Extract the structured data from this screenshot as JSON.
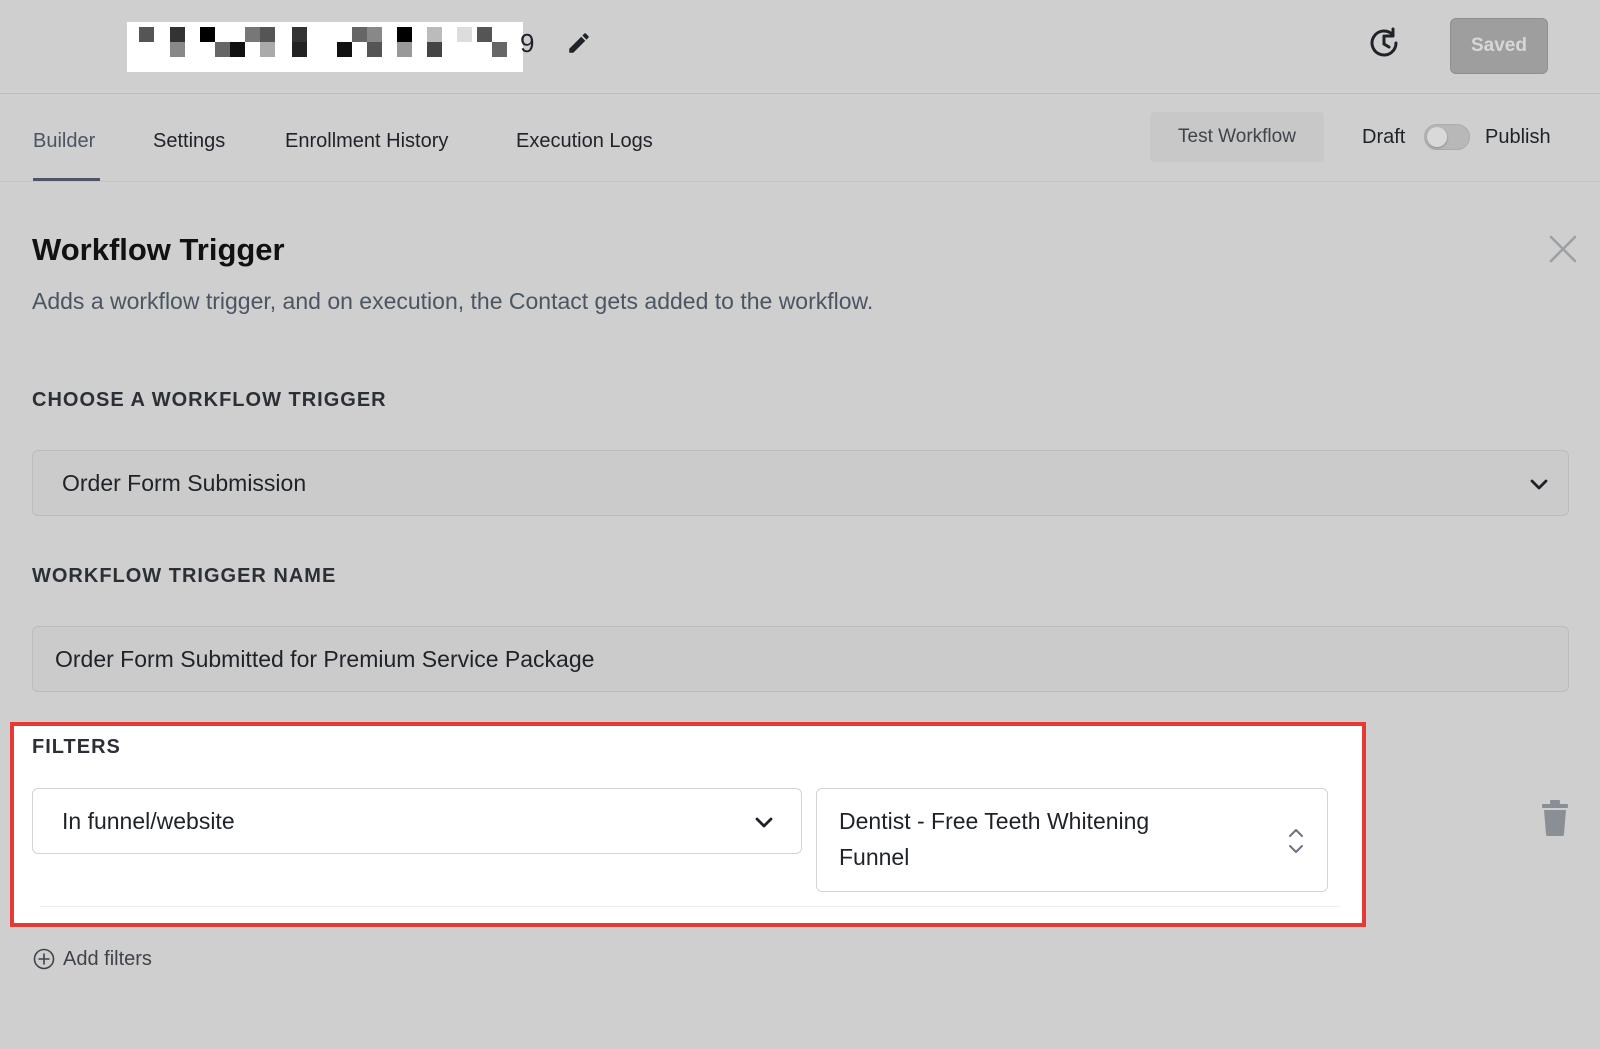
{
  "header": {
    "workflow_name_suffix": "9",
    "saved_label": "Saved",
    "icons": [
      "edit-icon",
      "history-icon"
    ]
  },
  "tabs": [
    {
      "label": "Builder",
      "active": true
    },
    {
      "label": "Settings",
      "active": false
    },
    {
      "label": "Enrollment History",
      "active": false
    },
    {
      "label": "Execution Logs",
      "active": false
    }
  ],
  "actions": {
    "test_workflow_label": "Test Workflow",
    "draft_label": "Draft",
    "publish_label": "Publish",
    "publish_toggle_on": false
  },
  "panel": {
    "title": "Workflow Trigger",
    "subtitle": "Adds a workflow trigger, and on execution, the Contact gets added to the workflow.",
    "trigger_section_label": "CHOOSE A WORKFLOW TRIGGER",
    "trigger_value": "Order Form Submission",
    "name_section_label": "WORKFLOW TRIGGER NAME",
    "name_value": "Order Form Submitted for Premium Service Package",
    "filters_section_label": "FILTERS",
    "filter_field_value": "In funnel/website",
    "filter_value_line1": "Dentist - Free Teeth Whitening",
    "filter_value_line2": "Funnel",
    "add_filters_label": "Add filters"
  },
  "colors": {
    "highlight": "#e53935",
    "background": "#cfcfcf"
  }
}
